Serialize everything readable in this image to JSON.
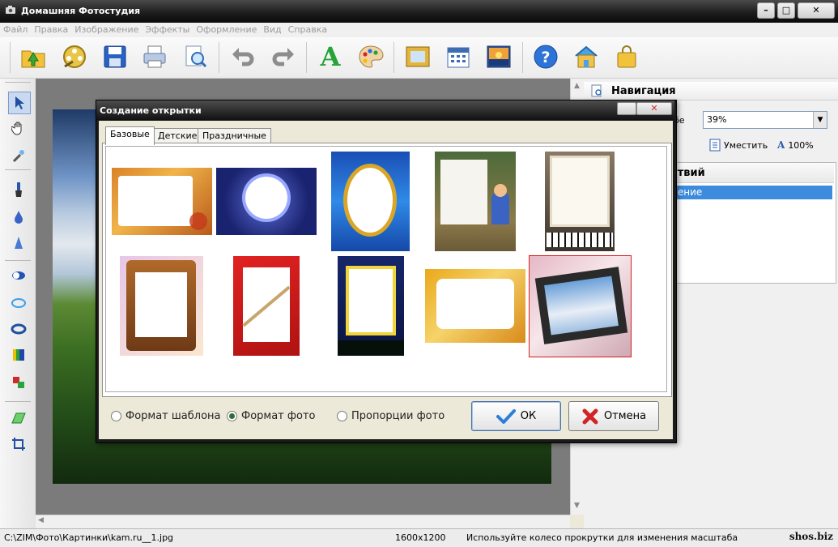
{
  "app": {
    "title": "Домашняя Фотостудия"
  },
  "menu": [
    "Файл",
    "Правка",
    "Изображение",
    "Эффекты",
    "Оформление",
    "Вид",
    "Справка"
  ],
  "toolbar": [
    "open-folder-icon",
    "film-reel-icon",
    "save-icon",
    "print-icon",
    "preview-icon",
    "undo-icon",
    "redo-icon",
    "text-a-icon",
    "palette-icon",
    "frame-icon",
    "calendar-icon",
    "picture-icon",
    "help-icon",
    "home-icon",
    "shopping-bag-icon"
  ],
  "left_tools": [
    "pointer-icon",
    "hand-icon",
    "magic-wand-icon",
    "brush-icon",
    "drop-icon",
    "cone-icon",
    "oval-icon",
    "ring-icon",
    "ring-dark-icon",
    "gradient-icon",
    "swap-colors-icon",
    "eraser-icon",
    "crop-icon"
  ],
  "navigation": {
    "title": "Навигация",
    "zoom_label": "бе",
    "zoom_value": "39%",
    "fit_label": "Уместить",
    "full_label": "100%"
  },
  "history": {
    "title": "ствий",
    "item": "нение"
  },
  "dialog": {
    "title": "Создание открытки",
    "tabs": [
      "Базовые",
      "Детские",
      "Праздничные"
    ],
    "active_tab": 0,
    "selected_template": 9,
    "format_options": [
      "Формат шаблона",
      "Формат фото",
      "Пропорции фото"
    ],
    "selected_format": 1,
    "ok_label": "ОК",
    "cancel_label": "Отмена"
  },
  "status": {
    "path": "C:\\ZIM\\Фото\\Картинки\\kam.ru__1.jpg",
    "size": "1600x1200",
    "hint": "Используйте колесо прокрутки для изменения масштаба",
    "watermark": "shos.biz"
  },
  "colors": {
    "accent_blue": "#3c8bdc",
    "selection_red": "#d42020",
    "titlebar": "#1e1e1e"
  }
}
